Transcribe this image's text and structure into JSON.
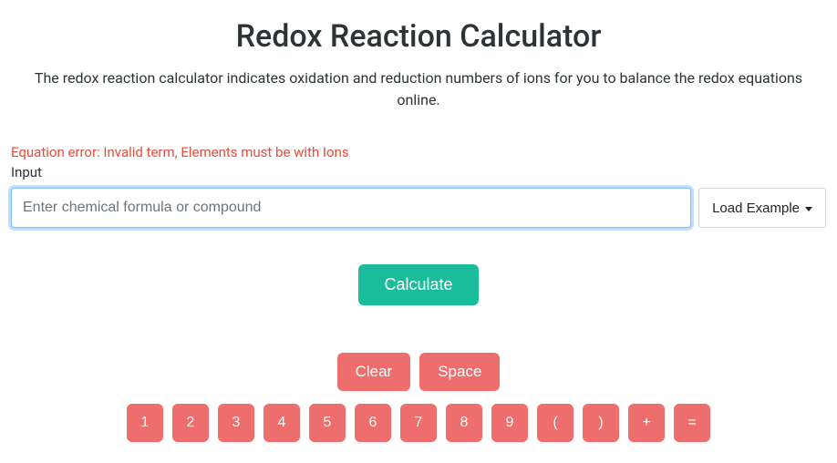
{
  "header": {
    "title": "Redox Reaction Calculator",
    "subtitle": "The redox reaction calculator indicates oxidation and reduction numbers of ions for you to balance the redox equations online."
  },
  "form": {
    "error": "Equation error: Invalid term, Elements must be with Ions",
    "input_label": "Input",
    "input_placeholder": "Enter chemical formula or compound",
    "input_value": "",
    "load_example_label": "Load Example"
  },
  "actions": {
    "calculate": "Calculate"
  },
  "keypad": {
    "clear": "Clear",
    "space": "Space",
    "keys": [
      "1",
      "2",
      "3",
      "4",
      "5",
      "6",
      "7",
      "8",
      "9",
      "(",
      ")",
      "+",
      "="
    ]
  }
}
